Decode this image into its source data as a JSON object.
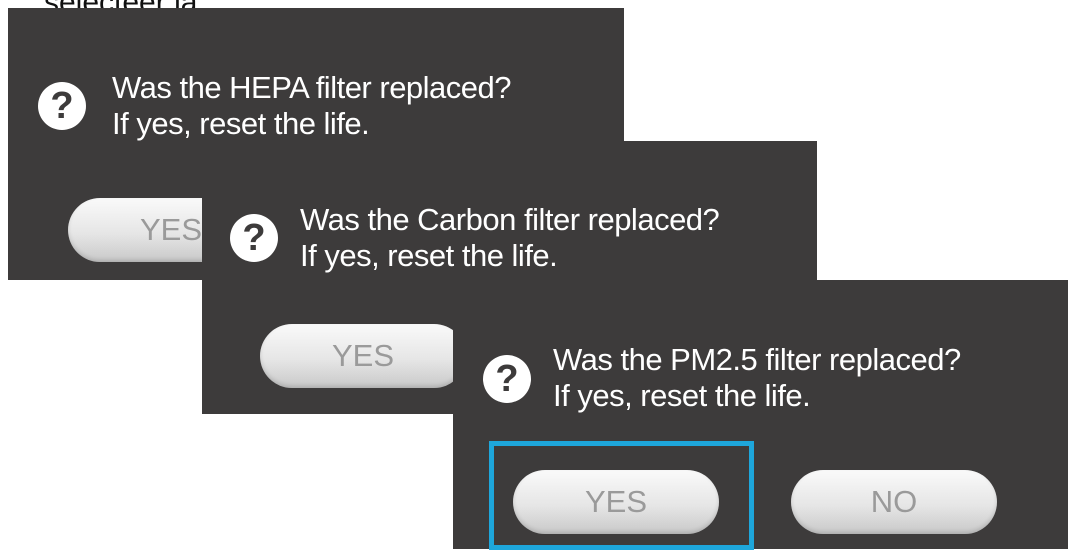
{
  "caption": "selecteer ja.",
  "dialogs": [
    {
      "message_line1": "Was the HEPA filter replaced?",
      "message_line2": "If yes, reset the life.",
      "yes_label": "YES"
    },
    {
      "message_line1": "Was the Carbon filter replaced?",
      "message_line2": "If yes, reset the life.",
      "yes_label": "YES"
    },
    {
      "message_line1": "Was the PM2.5 filter replaced?",
      "message_line2": "If yes, reset the life.",
      "yes_label": "YES",
      "no_label": "NO"
    }
  ],
  "icons": {
    "question": "?"
  },
  "colors": {
    "dialog_bg": "#3d3b3b",
    "focus_ring": "#1ea6db",
    "button_text": "#9a9a9a"
  }
}
